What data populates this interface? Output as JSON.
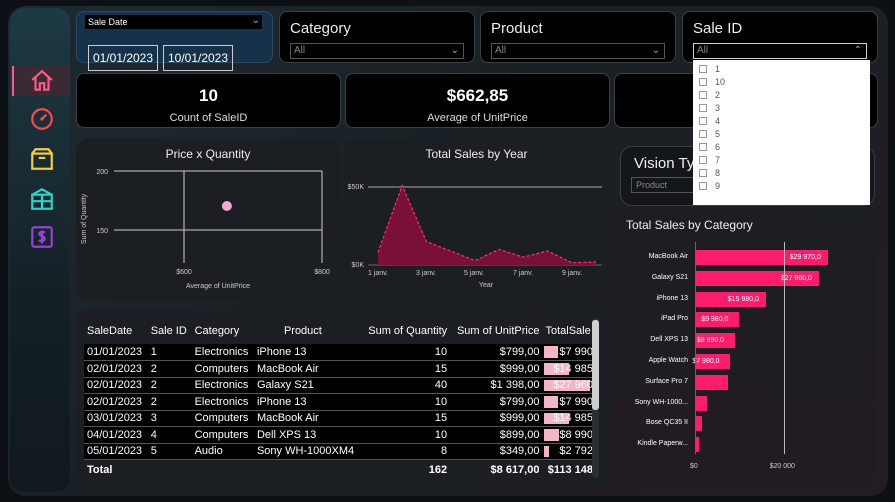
{
  "filters": {
    "sale_date": {
      "title": "Sale Date",
      "from": "01/01/2023",
      "to": "10/01/2023"
    },
    "category": {
      "title": "Category",
      "value": "All"
    },
    "product": {
      "title": "Product",
      "value": "All"
    },
    "sale_id": {
      "title": "Sale ID",
      "value": "All",
      "options": [
        "1",
        "10",
        "2",
        "3",
        "4",
        "5",
        "6",
        "7",
        "8",
        "9"
      ]
    },
    "vision_type": {
      "title": "Vision Typ",
      "placeholder": "Product"
    }
  },
  "kpis": [
    {
      "value": "10",
      "label": "Count of SaleID"
    },
    {
      "value": "$662,85",
      "label": "Average of UnitPrice"
    }
  ],
  "scatter": {
    "title": "Price x Quantity",
    "ylabel": "Sum of Quantity",
    "xlabel": "Average of UnitPrice",
    "yticks": [
      "200",
      "150"
    ],
    "xticks": [
      "$600",
      "$800"
    ]
  },
  "area": {
    "title": "Total Sales by Year",
    "yticks": [
      "$50K",
      "$0K"
    ],
    "xticks": [
      "1 janv.",
      "3 janv.",
      "5 janv.",
      "7 janv.",
      "9 janv."
    ],
    "xlabel": "Year"
  },
  "bars": {
    "title": "Total Sales by Category",
    "xticks": [
      "$0",
      "$20 000"
    ]
  },
  "table": {
    "columns": [
      "SaleDate",
      "Sale ID",
      "Category",
      "Product",
      "Sum of Quantity",
      "Sum of UnitPrice",
      "TotalSale"
    ],
    "rows": [
      {
        "date": "01/01/2023",
        "id": "1",
        "cat": "Electronics",
        "prod": "iPhone 13",
        "qty": "10",
        "price": "$799,00",
        "total": "$7 990"
      },
      {
        "date": "02/01/2023",
        "id": "2",
        "cat": "Computers",
        "prod": "MacBook Air",
        "qty": "15",
        "price": "$999,00",
        "total": "$14 985"
      },
      {
        "date": "02/01/2023",
        "id": "2",
        "cat": "Electronics",
        "prod": "Galaxy S21",
        "qty": "40",
        "price": "$1 398,00",
        "total": "$27 960"
      },
      {
        "date": "02/01/2023",
        "id": "2",
        "cat": "Electronics",
        "prod": "iPhone 13",
        "qty": "10",
        "price": "$799,00",
        "total": "$7 990"
      },
      {
        "date": "03/01/2023",
        "id": "3",
        "cat": "Computers",
        "prod": "MacBook Air",
        "qty": "15",
        "price": "$999,00",
        "total": "$14 985"
      },
      {
        "date": "04/01/2023",
        "id": "4",
        "cat": "Computers",
        "prod": "Dell XPS 13",
        "qty": "10",
        "price": "$899,00",
        "total": "$8 990"
      },
      {
        "date": "05/01/2023",
        "id": "5",
        "cat": "Audio",
        "prod": "Sony WH-1000XM4",
        "qty": "8",
        "price": "$349,00",
        "total": "$2 792"
      }
    ],
    "total": {
      "label": "Total",
      "qty": "162",
      "price": "$8 617,00",
      "total": "$113 148"
    }
  },
  "chart_data": [
    {
      "type": "scatter",
      "title": "Price x Quantity",
      "xlabel": "Average of UnitPrice",
      "ylabel": "Sum of Quantity",
      "x": [
        662.85
      ],
      "y": [
        162
      ],
      "xlim": [
        500,
        800
      ],
      "ylim": [
        100,
        200
      ]
    },
    {
      "type": "area",
      "title": "Total Sales by Year",
      "xlabel": "Year",
      "x": [
        "1 janv.",
        "2 janv.",
        "3 janv.",
        "4 janv.",
        "5 janv.",
        "6 janv.",
        "7 janv.",
        "8 janv.",
        "9 janv.",
        "10 janv."
      ],
      "y": [
        7990,
        50935,
        14985,
        8990,
        2792,
        9980,
        4990,
        8990,
        1500,
        1996
      ],
      "ylim": [
        0,
        60000
      ]
    },
    {
      "type": "bar",
      "title": "Total Sales by Category",
      "categories": [
        "MacBook Air",
        "Galaxy S21",
        "iPhone 13",
        "iPad Pro",
        "Dell XPS 13",
        "Apple Watch",
        "Surface Pro 7",
        "Sony WH-1000...",
        "Bose QC35 II",
        "Kindle Paperw..."
      ],
      "values": [
        29970,
        27960,
        15980,
        9980,
        8990,
        7980,
        7500,
        2792,
        1500,
        900
      ],
      "value_labels": [
        "$29 970,0",
        "$27 960,0",
        "$15 980,0",
        "$9 980,0",
        "$8 990,0",
        "$7 980,0",
        "",
        "",
        "",
        ""
      ],
      "xlim": [
        0,
        35000
      ]
    }
  ],
  "colors": {
    "accent": "#ff1c6c",
    "area_fill": "#7a0f3a",
    "area_line": "#ff2d7a",
    "scatter_point": "#f4a9d4"
  },
  "icons": [
    "home-icon",
    "gauge-icon",
    "box-icon",
    "package-icon",
    "dollar-icon"
  ]
}
